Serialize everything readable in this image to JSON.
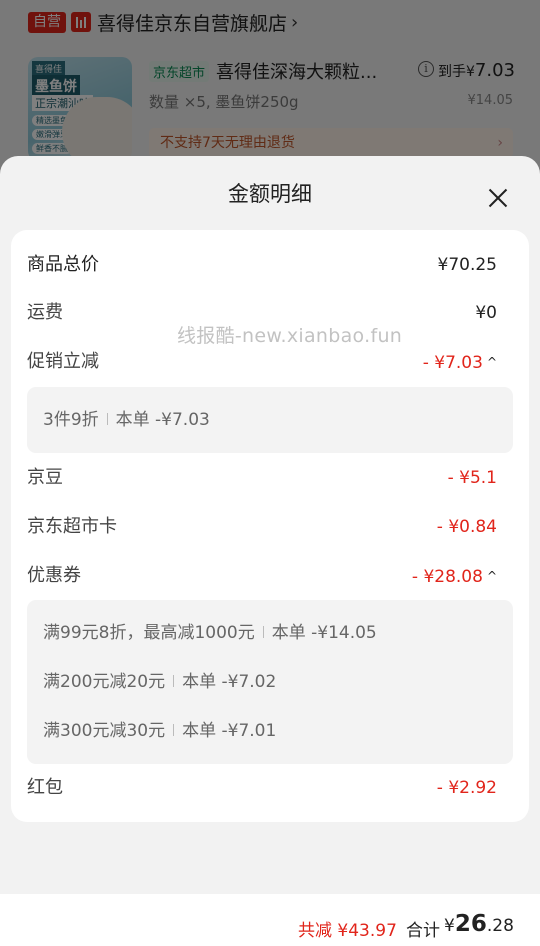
{
  "background": {
    "shop": {
      "badge": "自营",
      "name": "喜得佳京东自营旗舰店",
      "chevron": "›"
    },
    "product": {
      "image_texts": {
        "tag": "喜得佳",
        "title1": "墨鱼饼",
        "title2": "正宗潮汕味",
        "pills": [
          "精选墨鱼",
          "嫩滑弹牙",
          "鲜香不腻"
        ]
      },
      "store_tag": "京东超市",
      "title": "喜得佳深海大颗粒...",
      "net_price_label": "到手¥",
      "net_price_value": "7.03",
      "qty_line": "数量 ×5, 墨鱼饼250g",
      "orig_price": "¥14.05",
      "no_return_notice": "不支持7天无理由退货",
      "chevron": "›"
    }
  },
  "sheet": {
    "title": "金额明细",
    "watermark": "线报酷-new.xianbao.fun",
    "rows": {
      "goods_total": {
        "label": "商品总价",
        "value": "¥70.25"
      },
      "shipping": {
        "label": "运费",
        "value": "¥0"
      },
      "promo": {
        "label": "促销立减",
        "value": "- ¥7.03",
        "caret": "^"
      },
      "jingdou": {
        "label": "京豆",
        "value": "- ¥5.1"
      },
      "market_card": {
        "label": "京东超市卡",
        "value": "- ¥0.84"
      },
      "coupon": {
        "label": "优惠券",
        "value": "- ¥28.08",
        "caret": "^"
      },
      "red_packet": {
        "label": "红包",
        "value": "- ¥2.92"
      }
    },
    "promo_details": [
      {
        "rule": "3件9折",
        "amount": "本单 -¥7.03"
      }
    ],
    "coupon_details": [
      {
        "rule": "满99元8折，最高减1000元",
        "amount": "本单 -¥14.05"
      },
      {
        "rule": "满200元减20元",
        "amount": "本单 -¥7.02"
      },
      {
        "rule": "满300元减30元",
        "amount": "本单 -¥7.01"
      }
    ]
  },
  "footer": {
    "saved": "共减 ¥43.97",
    "total_label": "合计",
    "total_currency": "¥",
    "total_int": "26",
    "total_dec": ".28"
  },
  "colors": {
    "accent_red": "#e1251b",
    "supermarket_green": "#0a8a55"
  }
}
